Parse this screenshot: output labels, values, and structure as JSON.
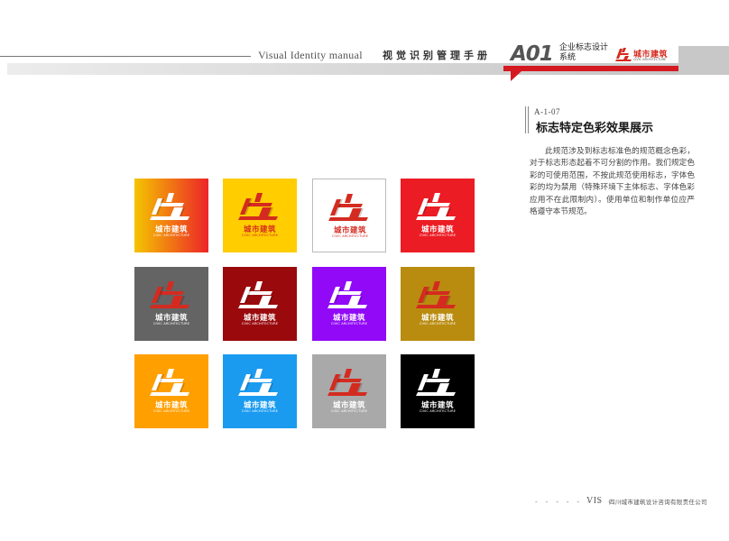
{
  "header": {
    "english_title": "Visual Identity manual",
    "chinese_title": "视觉识别管理手册",
    "section_code": "A01",
    "section_title": "企业标志设计系统",
    "logo_name_cn": "城市建筑",
    "logo_name_en": "CIVIC ARCHITECTURE"
  },
  "page": {
    "item_code": "A-1-07",
    "item_title": "标志特定色彩效果展示",
    "description": "此规范涉及到标志标准色的规范概念色彩，对于标志形态起着不可分割的作用。我们规定色彩的可使用范围，不按此规范使用标志，字体色彩的均为禁用（特殊环境下主体标志、字体色彩应用不在此限制内）。使用单位和制作单位应严格遵守本节规范。"
  },
  "swatches": {
    "logo_text_cn": "城市建筑",
    "logo_text_en": "CIVIC ARCHITECTURE",
    "items": [
      {
        "background": "#f5c400",
        "background_end": "#ec2528",
        "gradient": true,
        "mark_color": "#ffffff",
        "text_color": "#ffffff"
      },
      {
        "background": "#ffcd00",
        "gradient": false,
        "mark_color": "#d42b20",
        "text_color": "#d42b20"
      },
      {
        "background": "#ffffff",
        "gradient": false,
        "mark_color": "#d42b20",
        "text_color": "#d42b20",
        "border": true
      },
      {
        "background": "#ec1c24",
        "gradient": false,
        "mark_color": "#ffffff",
        "text_color": "#ffffff"
      },
      {
        "background": "#646464",
        "gradient": false,
        "mark_color": "#d42b20",
        "text_color": "#ffffff"
      },
      {
        "background": "#9a0a0d",
        "gradient": false,
        "mark_color": "#ffffff",
        "text_color": "#ffffff"
      },
      {
        "background": "#9109f7",
        "gradient": false,
        "mark_color": "#ffffff",
        "text_color": "#ffffff"
      },
      {
        "background": "#b98c10",
        "gradient": false,
        "mark_color": "#d42b20",
        "text_color": "#ffffff"
      },
      {
        "background": "#ff9f00",
        "gradient": false,
        "mark_color": "#ffffff",
        "text_color": "#ffffff"
      },
      {
        "background": "#1a9bf0",
        "gradient": false,
        "mark_color": "#ffffff",
        "text_color": "#ffffff"
      },
      {
        "background": "#a9a9a9",
        "gradient": false,
        "mark_color": "#d42b20",
        "text_color": "#ffffff"
      },
      {
        "background": "#000000",
        "gradient": false,
        "mark_color": "#ffffff",
        "text_color": "#ffffff"
      }
    ]
  },
  "footer": {
    "dashes": "- - - - - - - - - - -",
    "vis": "VIS",
    "company": "四川城市建筑设计咨询有限责任公司"
  }
}
